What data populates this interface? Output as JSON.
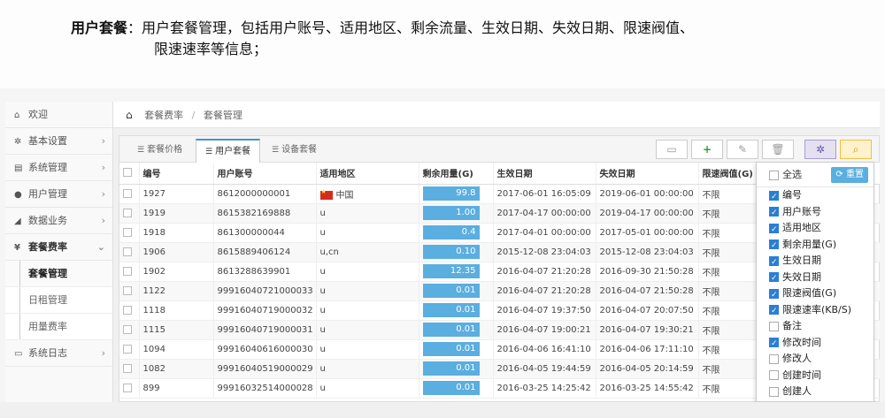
{
  "description": {
    "heading": "用户套餐",
    "line1": "：用户套餐管理，包括用户账号、适用地区、剩余流量、生效日期、失效日期、限速阀值、",
    "line2": "限速速率等信息；"
  },
  "sidebar": {
    "items": [
      {
        "icon": "home-icon",
        "glyph": "⌂",
        "label": "欢迎"
      },
      {
        "icon": "gear-icon",
        "glyph": "✲",
        "label": "基本设置"
      },
      {
        "icon": "system-icon",
        "glyph": "▤",
        "label": "系统管理"
      },
      {
        "icon": "users-icon",
        "glyph": "●",
        "label": "用户管理"
      },
      {
        "icon": "rss-icon",
        "glyph": "◢",
        "label": "数据业务"
      },
      {
        "icon": "yen-icon",
        "glyph": "¥",
        "label": "套餐费率"
      }
    ],
    "subitems": [
      "套餐管理",
      "日租管理",
      "用量费率"
    ],
    "log": {
      "icon": "log-icon",
      "glyph": "▭",
      "label": "系统日志"
    }
  },
  "breadcrumb": {
    "parent": "套餐费率",
    "sep": "/",
    "current": "套餐管理"
  },
  "tabs": [
    "套餐价格",
    "用户套餐",
    "设备套餐"
  ],
  "columns": [
    "编号",
    "用户账号",
    "适用地区",
    "剩余用量(G)",
    "生效日期",
    "失效日期",
    "限速阀值(G)"
  ],
  "rows": [
    {
      "id": "1927",
      "account": "8612000000001",
      "region": "中国",
      "flag": true,
      "remain": "99.8",
      "start": "2017-06-01 16:05:09",
      "end": "2019-06-01 00:00:00",
      "limit": "不限"
    },
    {
      "id": "1919",
      "account": "8615382169888",
      "region": "u",
      "flag": false,
      "remain": "1.00",
      "start": "2017-04-17 00:00:00",
      "end": "2019-04-17 00:00:00",
      "limit": "不限"
    },
    {
      "id": "1918",
      "account": "861300000044",
      "region": "u",
      "flag": false,
      "remain": "0.4",
      "start": "2017-04-01 00:00:00",
      "end": "2017-05-01 00:00:00",
      "limit": "不限"
    },
    {
      "id": "1906",
      "account": "8615889406124",
      "region": "u,cn",
      "flag": false,
      "remain": "0.10",
      "start": "2015-12-08 23:04:03",
      "end": "2015-12-08 23:04:03",
      "limit": "不限"
    },
    {
      "id": "1902",
      "account": "8613288639901",
      "region": "u",
      "flag": false,
      "remain": "12.35",
      "start": "2016-04-07 21:20:28",
      "end": "2016-09-30 21:50:28",
      "limit": "不限"
    },
    {
      "id": "1122",
      "account": "99916040721000033",
      "region": "u",
      "flag": false,
      "remain": "0.01",
      "start": "2016-04-07 21:20:28",
      "end": "2016-04-07 21:50:28",
      "limit": "不限"
    },
    {
      "id": "1118",
      "account": "99916040719000032",
      "region": "u",
      "flag": false,
      "remain": "0.01",
      "start": "2016-04-07 19:37:50",
      "end": "2016-04-07 20:07:50",
      "limit": "不限"
    },
    {
      "id": "1115",
      "account": "99916040719000031",
      "region": "u",
      "flag": false,
      "remain": "0.01",
      "start": "2016-04-07 19:00:21",
      "end": "2016-04-07 19:30:21",
      "limit": "不限"
    },
    {
      "id": "1094",
      "account": "99916040616000030",
      "region": "u",
      "flag": false,
      "remain": "0.01",
      "start": "2016-04-06 16:41:10",
      "end": "2016-04-06 17:11:10",
      "limit": "不限"
    },
    {
      "id": "1082",
      "account": "99916040519000029",
      "region": "u",
      "flag": false,
      "remain": "0.01",
      "start": "2016-04-05 19:44:59",
      "end": "2016-04-05 20:14:59",
      "limit": "不限"
    },
    {
      "id": "899",
      "account": "99916032514000028",
      "region": "u",
      "flag": false,
      "remain": "0.01",
      "start": "2016-03-25 14:25:42",
      "end": "2016-03-25 14:55:42",
      "limit": "不限"
    }
  ],
  "column_panel": {
    "select_all": "全选",
    "reset": "重置",
    "options": [
      {
        "label": "编号",
        "checked": true
      },
      {
        "label": "用户账号",
        "checked": true
      },
      {
        "label": "适用地区",
        "checked": true
      },
      {
        "label": "剩余用量(G)",
        "checked": true
      },
      {
        "label": "生效日期",
        "checked": true
      },
      {
        "label": "失效日期",
        "checked": true
      },
      {
        "label": "限速阀值(G)",
        "checked": true
      },
      {
        "label": "限速速率(KB/S)",
        "checked": true
      },
      {
        "label": "备注",
        "checked": false
      },
      {
        "label": "修改时间",
        "checked": true
      },
      {
        "label": "修改人",
        "checked": false
      },
      {
        "label": "创建时间",
        "checked": false
      },
      {
        "label": "创建人",
        "checked": false
      }
    ]
  },
  "colors": {
    "accent": "#5aaee0",
    "checkbox": "#2a7fd4"
  }
}
